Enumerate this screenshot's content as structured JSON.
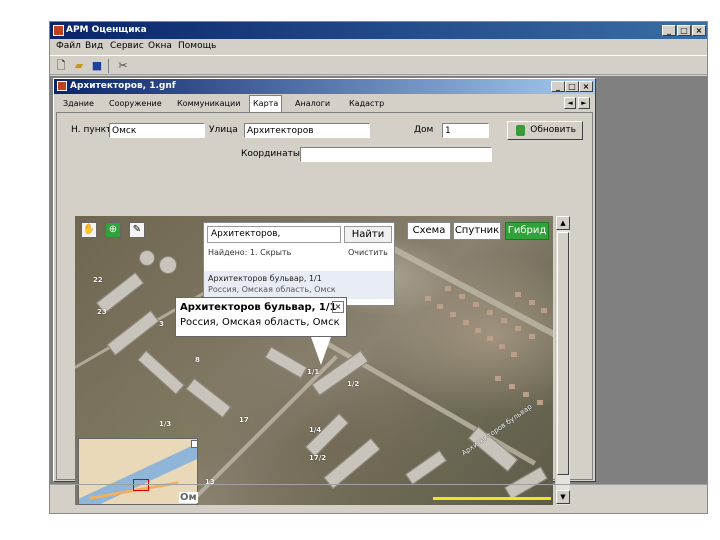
{
  "app": {
    "title": "АРМ Оценщика",
    "menu": [
      "Файл",
      "Вид",
      "Сервис",
      "Окна",
      "Помощь"
    ],
    "caption_buttons": [
      "_",
      "□",
      "×"
    ]
  },
  "toolbar": {
    "icons": [
      "new-file-icon",
      "open-folder-icon",
      "save-icon",
      "tools-icon"
    ]
  },
  "document": {
    "title": "Архитекторов, 1.gnf",
    "tabs": [
      "Здание",
      "Сооружение",
      "Коммуникации",
      "Карта",
      "Аналоги",
      "Кадастр"
    ],
    "active_tab": "Карта",
    "nav": [
      "◄",
      "►"
    ]
  },
  "form": {
    "city_label": "Н. пункт",
    "city_value": "Омск",
    "street_label": "Улица",
    "street_value": "Архитекторов",
    "house_label": "Дом",
    "house_value": "1",
    "coords_label": "Координаты",
    "coords_value": "",
    "find_button": "Обновить"
  },
  "map": {
    "search_value": "Архитекторов,",
    "search_button": "Найти",
    "found_text": "Найдено: 1. Скрыть",
    "clear_text": "Очистить",
    "result_title": "Архитекторов бульвар, 1/1",
    "result_subtitle": "Россия, Омская область, Омск",
    "balloon_title": "Архитекторов бульвар, 1/1",
    "balloon_subtitle": "Россия, Омская область, Омск",
    "map_types": [
      "Схема",
      "Спутник",
      "Гибрид"
    ],
    "active_map_type": "Гибрид",
    "active_color": "#2fa33a",
    "building_numbers": [
      "22",
      "23",
      "3",
      "8",
      "1/1",
      "1/2",
      "1/3",
      "17",
      "1/4",
      "17/2",
      "13"
    ],
    "street_label": "Архитекторов бульвар",
    "minimap_label": "Ом"
  }
}
